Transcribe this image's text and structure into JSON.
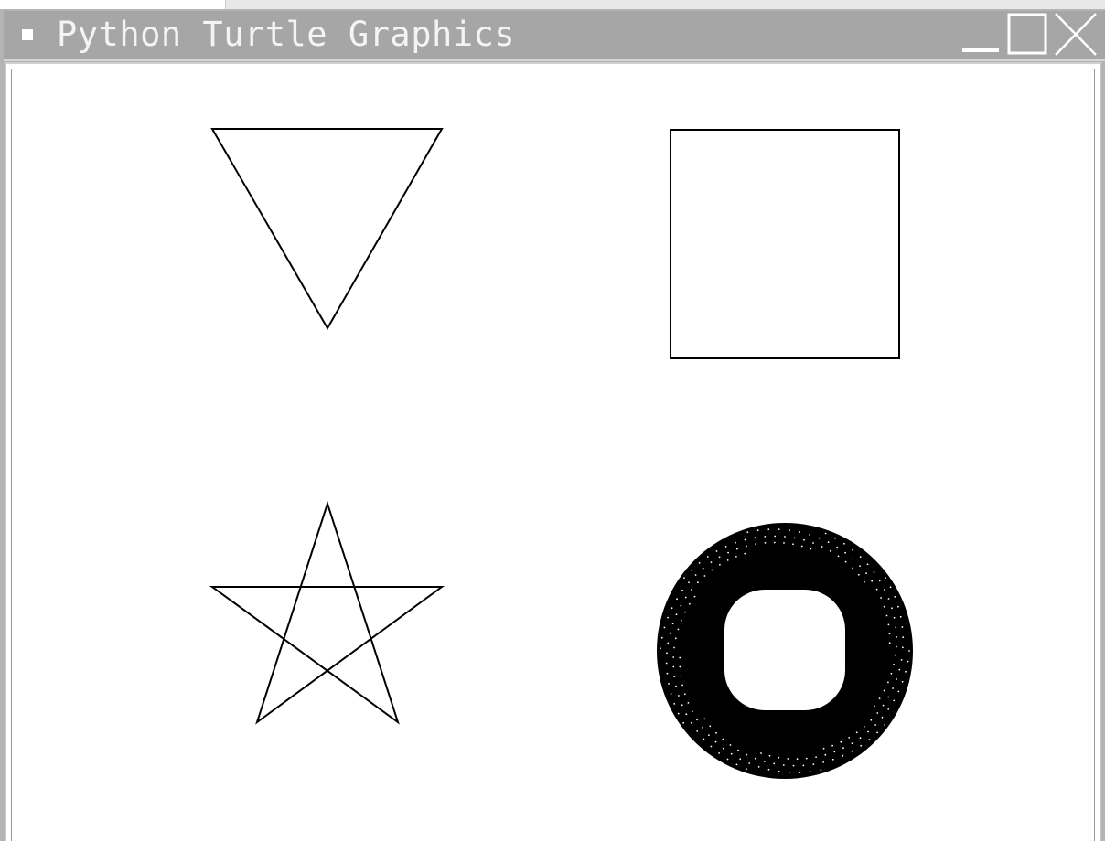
{
  "window": {
    "title": "Python Turtle Graphics"
  },
  "controls": {
    "minimize_icon": "minimize-icon",
    "maximize_icon": "maximize-icon",
    "close_icon": "close-icon"
  },
  "canvas": {
    "background": "#ffffff",
    "stroke": "#000000",
    "shapes": [
      "triangle",
      "square",
      "star",
      "donut"
    ]
  },
  "colors": {
    "titlebar": "#a6a6a6",
    "title_text": "#f4f4f4",
    "pen": "#000000"
  }
}
